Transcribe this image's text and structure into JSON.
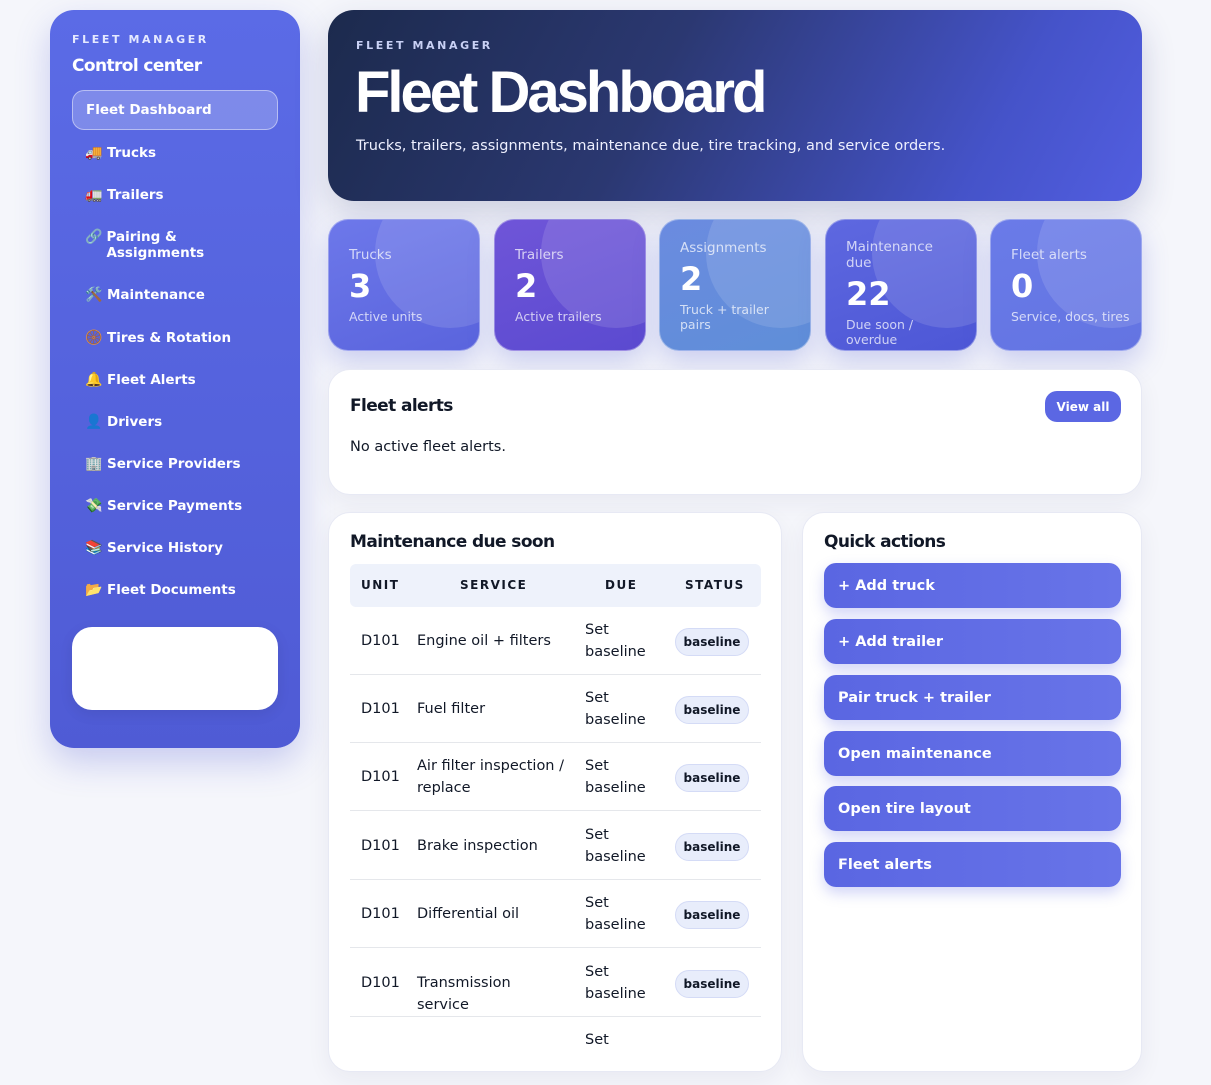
{
  "sidebar": {
    "eyebrow": "FLEET MANAGER",
    "subtitle": "Control center",
    "items": [
      {
        "icon": "",
        "label": "Fleet Dashboard",
        "active": true
      },
      {
        "icon": "🚚",
        "label": "Trucks"
      },
      {
        "icon": "🚛",
        "label": "Trailers"
      },
      {
        "icon": "🔗",
        "label": "Pairing & Assignments"
      },
      {
        "icon": "🛠️",
        "label": "Maintenance"
      },
      {
        "icon": "🛞",
        "label": "Tires & Rotation"
      },
      {
        "icon": "🔔",
        "label": "Fleet Alerts"
      },
      {
        "icon": "👤",
        "label": "Drivers"
      },
      {
        "icon": "🏢",
        "label": "Service Providers"
      },
      {
        "icon": "💸",
        "label": "Service Payments"
      },
      {
        "icon": "📚",
        "label": "Service History"
      },
      {
        "icon": "📂",
        "label": "Fleet Documents"
      }
    ]
  },
  "hero": {
    "eyebrow": "FLEET MANAGER",
    "title": "Fleet Dashboard",
    "description": "Trucks, trailers, assignments, maintenance due, tire tracking, and service orders."
  },
  "stats": [
    {
      "label": "Trucks",
      "value": "3",
      "sub": "Active units"
    },
    {
      "label": "Trailers",
      "value": "2",
      "sub": "Active trailers"
    },
    {
      "label": "Assignments",
      "value": "2",
      "sub": "Truck + trailer pairs"
    },
    {
      "label": "Maintenance due",
      "value": "22",
      "sub": "Due soon / overdue"
    },
    {
      "label": "Fleet alerts",
      "value": "0",
      "sub": "Service, docs, tires"
    }
  ],
  "alerts": {
    "title": "Fleet alerts",
    "view_all_label": "View all",
    "empty_text": "No active fleet alerts."
  },
  "maintenance": {
    "title": "Maintenance due soon",
    "columns": [
      "UNIT",
      "SERVICE",
      "DUE",
      "STATUS"
    ],
    "rows": [
      {
        "unit": "D101",
        "service": "Engine oil + filters",
        "due": "Set baseline",
        "status": "baseline"
      },
      {
        "unit": "D101",
        "service": "Fuel filter",
        "due": "Set baseline",
        "status": "baseline"
      },
      {
        "unit": "D101",
        "service": "Air filter inspection / replace",
        "due": "Set baseline",
        "status": "baseline"
      },
      {
        "unit": "D101",
        "service": "Brake inspection",
        "due": "Set baseline",
        "status": "baseline"
      },
      {
        "unit": "D101",
        "service": "Differential oil",
        "due": "Set baseline",
        "status": "baseline"
      },
      {
        "unit": "D101",
        "service": "Transmission service",
        "due": "Set baseline",
        "status": "baseline"
      },
      {
        "unit": "",
        "service": "",
        "due": "Set",
        "status": ""
      }
    ]
  },
  "quick_actions": {
    "title": "Quick actions",
    "buttons": [
      "+ Add truck",
      "+ Add trailer",
      "Pair truck + trailer",
      "Open maintenance",
      "Open tire layout",
      "Fleet alerts"
    ]
  }
}
